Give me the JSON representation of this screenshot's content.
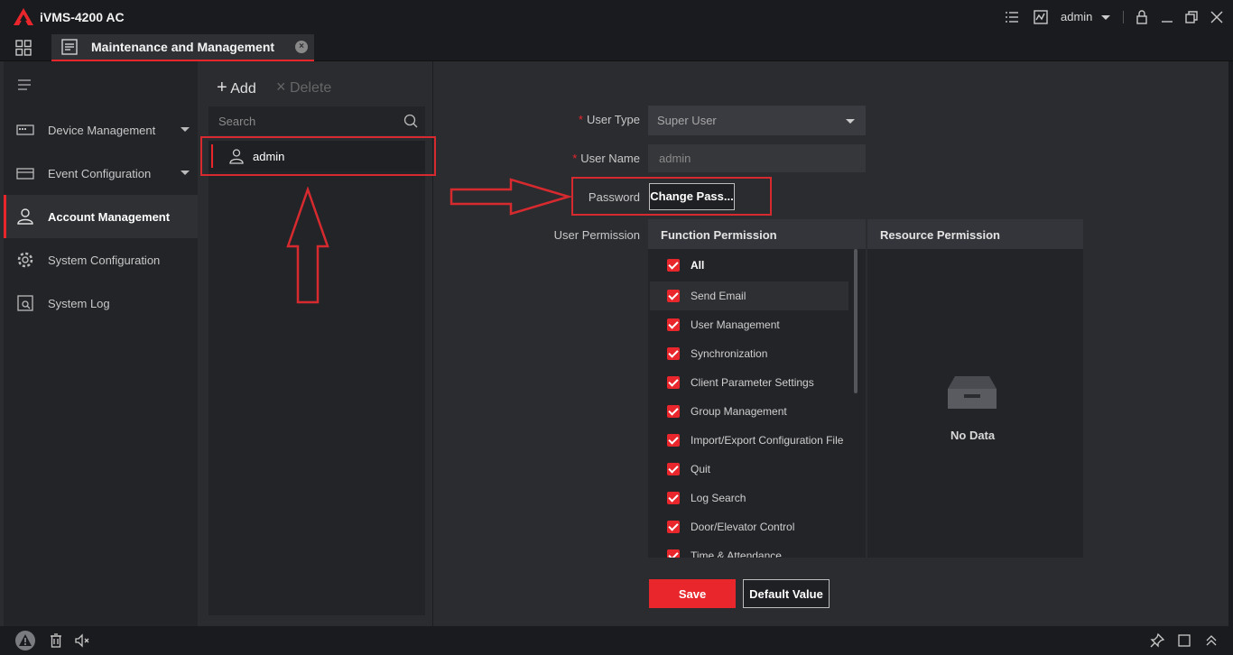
{
  "app": {
    "title": "iVMS-4200 AC",
    "user": "admin"
  },
  "tab": {
    "label": "Maintenance and Management"
  },
  "sidebar": {
    "items": [
      {
        "label": "Device Management",
        "icon": "device-icon",
        "caret": true
      },
      {
        "label": "Event Configuration",
        "icon": "event-icon",
        "caret": true
      },
      {
        "label": "Account Management",
        "icon": "user-icon",
        "active": true
      },
      {
        "label": "System Configuration",
        "icon": "gear-icon"
      },
      {
        "label": "System Log",
        "icon": "log-icon"
      }
    ]
  },
  "userlist": {
    "add_label": "Add",
    "delete_label": "Delete",
    "search_placeholder": "Search",
    "users": [
      {
        "name": "admin"
      }
    ]
  },
  "form": {
    "user_type_label": "User Type",
    "user_type_value": "Super User",
    "user_name_label": "User Name",
    "user_name_value": "admin",
    "password_label": "Password",
    "change_pass_label": "Change Pass...",
    "user_permission_label": "User Permission",
    "function_permission_header": "Function Permission",
    "resource_permission_header": "Resource Permission",
    "no_data": "No Data",
    "permissions": [
      "All",
      "Send Email",
      "User Management",
      "Synchronization",
      "Client Parameter Settings",
      "Group Management",
      "Import/Export Configuration File",
      "Quit",
      "Log Search",
      "Door/Elevator Control",
      "Time & Attendance"
    ],
    "save_label": "Save",
    "default_label": "Default Value"
  },
  "colors": {
    "accent": "#e8262c",
    "annotation": "#d72a2f"
  }
}
